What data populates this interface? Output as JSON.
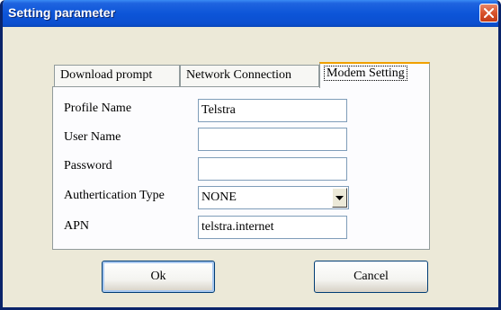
{
  "window": {
    "title": "Setting parameter"
  },
  "tabs": [
    {
      "label": "Download prompt",
      "active": false
    },
    {
      "label": "Network Connection",
      "active": false
    },
    {
      "label": "Modem Setting",
      "active": true
    }
  ],
  "form": {
    "profile_name": {
      "label": "Profile Name",
      "value": "Telstra"
    },
    "user_name": {
      "label": "User Name",
      "value": ""
    },
    "password": {
      "label": "Password",
      "value": ""
    },
    "auth_type": {
      "label": "Authertication Type",
      "value": "NONE"
    },
    "apn": {
      "label": "APN",
      "value": "telstra.internet"
    }
  },
  "buttons": {
    "ok": "Ok",
    "cancel": "Cancel"
  },
  "icons": {
    "close": "close-icon",
    "dropdown": "chevron-down-icon"
  },
  "colors": {
    "titlebar": "#0b4fd0",
    "close_button": "#d8532b",
    "active_tab_accent": "#f0a000"
  }
}
